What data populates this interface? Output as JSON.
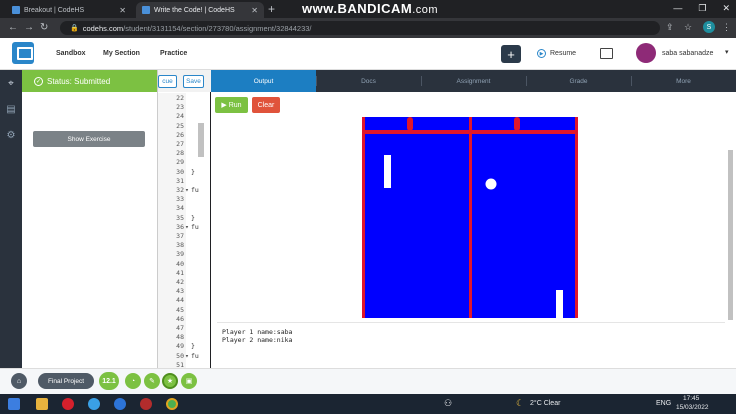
{
  "browser": {
    "tabs": [
      {
        "title": "Breakout | CodeHS",
        "active": false
      },
      {
        "title": "Write the Code! | CodeHS",
        "active": true
      }
    ],
    "new_tab_symbol": "+",
    "watermark": {
      "brand": "www.BANDICAM",
      "tld": ".com"
    },
    "window_controls": [
      "—",
      "❐",
      "✕"
    ],
    "url_host": "codehs.com",
    "url_path": "/student/3131154/section/273780/assignment/32844233/",
    "profile_initial": "S"
  },
  "app": {
    "nav": [
      "Sandbox",
      "My Section",
      "Practice"
    ],
    "plus": "+",
    "resume": "Resume",
    "username": "saba sabanadze",
    "chevron": "▾"
  },
  "status": {
    "label": "Status: Submitted",
    "check": "✓"
  },
  "left_panel": {
    "show_exercise": "Show Exercise"
  },
  "editor": {
    "buttons": {
      "cut": "cue",
      "save": "Save"
    },
    "lines": [
      "22",
      "23",
      "24",
      "25",
      "26",
      "27",
      "28",
      "29",
      "30",
      "31",
      "32",
      "33",
      "34",
      "35",
      "36",
      "37",
      "38",
      "39",
      "40",
      "41",
      "42",
      "43",
      "44",
      "45",
      "46",
      "47",
      "48",
      "49",
      "50",
      "51"
    ],
    "code": [
      {
        "line": 30,
        "text": "}"
      },
      {
        "line": 32,
        "text": "fu"
      },
      {
        "line": 35,
        "text": "}"
      },
      {
        "line": 36,
        "text": "fu"
      },
      {
        "line": 49,
        "text": "}"
      },
      {
        "line": 50,
        "text": "fu"
      }
    ],
    "fold_markers": [
      "32",
      "36",
      "50"
    ]
  },
  "output_tabs": [
    "Output",
    "Docs",
    "Assignment",
    "Grade",
    "More"
  ],
  "output": {
    "run": "▶ Run",
    "clear": "Clear",
    "console": [
      "Player 1 name:saba",
      "Player 2 name:nika"
    ]
  },
  "game": {
    "background_color": "#0000ff",
    "line_color": "#e0162b",
    "paddle_color": "#ffffff",
    "ball_color": "#ffffff"
  },
  "bottom_bar": {
    "final_project": "Final Project",
    "level_badge": "12.1"
  },
  "taskbar": {
    "weather": "2°C  Clear",
    "language": "ENG",
    "time": "17:45",
    "date": "15/03/2022"
  }
}
